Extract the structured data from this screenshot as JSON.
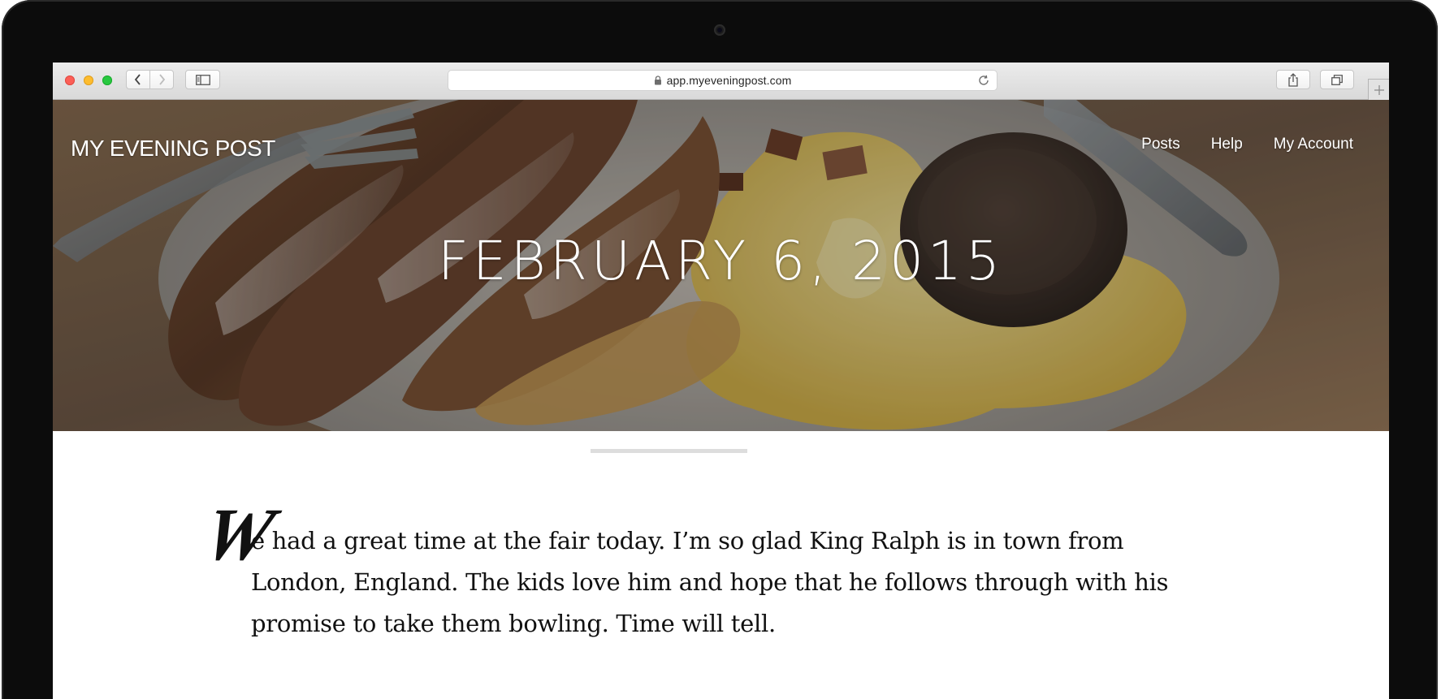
{
  "browser": {
    "url": "app.myeveningpost.com"
  },
  "site": {
    "logo": "MY EVENING POST",
    "nav": [
      "Posts",
      "Help",
      "My Account"
    ]
  },
  "post": {
    "date_title": "FEBRUARY 6, 2015",
    "drop_cap": "W",
    "body": "e had a great time at the fair today. I’m so glad King Ralph is in town from London, England. The kids love him and hope that he follows through with his promise to take them bowling. Time will tell."
  },
  "colors": {
    "bezel": "#0c0c0c",
    "toolbar": "#e0e0e0",
    "traffic_red": "#fc5f57",
    "traffic_yellow": "#fdbc2e",
    "traffic_green": "#28c840",
    "divider": "#dddddd"
  },
  "icons": {
    "lock": "lock-icon",
    "reload": "reload-icon",
    "share": "share-icon",
    "tabs": "tabs-overview-icon",
    "sidebar": "sidebar-icon",
    "back": "chevron-left-icon",
    "forward": "chevron-right-icon",
    "new_tab": "plus-icon"
  }
}
